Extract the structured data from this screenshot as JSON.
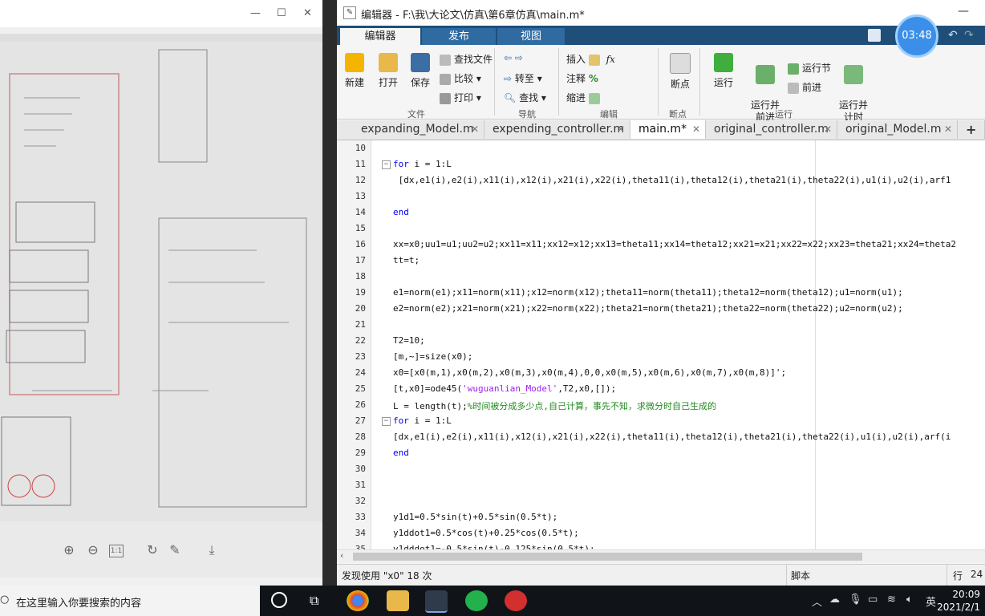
{
  "viewer": {
    "controls": {
      "minimize": "—",
      "maximize": "☐",
      "close": "✕"
    }
  },
  "editor": {
    "title": "编辑器 - F:\\我\\大论文\\仿真\\第6章仿真\\main.m*",
    "ribbon_tabs": [
      "编辑器",
      "发布",
      "视图"
    ],
    "file_group": {
      "new": "新建",
      "open": "打开",
      "save": "保存",
      "find_files": "查找文件",
      "compare": "比较",
      "print": "打印",
      "label": "文件"
    },
    "nav_group": {
      "goto": "转至",
      "find": "查找",
      "label": "导航"
    },
    "edit_group": {
      "insert": "插入",
      "comment": "注释",
      "indent": "缩进",
      "fx": "fx",
      "label": "编辑"
    },
    "breakpoint_group": {
      "breakpoints": "断点",
      "label": "断点"
    },
    "run_group": {
      "run": "运行",
      "run_advance": "运行并\n前进",
      "run_section": "运行节",
      "advance": "前进",
      "run_time": "运行并\n计时",
      "label": "运行"
    },
    "doc_tabs": [
      {
        "name": "expanding_Model.m",
        "active": false
      },
      {
        "name": "expending_controller.m",
        "active": false
      },
      {
        "name": "main.m*",
        "active": true
      },
      {
        "name": "original_controller.m",
        "active": false
      },
      {
        "name": "original_Model.m",
        "active": false
      }
    ],
    "add_tab": "+",
    "code_lines": [
      {
        "n": "10",
        "text": ""
      },
      {
        "n": "11",
        "text": "for i = 1:L"
      },
      {
        "n": "12",
        "text": " [dx,e1(i),e2(i),x11(i),x12(i),x21(i),x22(i),theta11(i),theta12(i),theta21(i),theta22(i),u1(i),u2(i),arf1"
      },
      {
        "n": "13",
        "text": ""
      },
      {
        "n": "14",
        "text": "end"
      },
      {
        "n": "15",
        "text": ""
      },
      {
        "n": "16",
        "text": "xx=x0;uu1=u1;uu2=u2;xx11=x11;xx12=x12;xx13=theta11;xx14=theta12;xx21=x21;xx22=x22;xx23=theta21;xx24=theta2"
      },
      {
        "n": "17",
        "text": "tt=t;"
      },
      {
        "n": "18",
        "text": ""
      },
      {
        "n": "19",
        "text": "e1=norm(e1);x11=norm(x11);x12=norm(x12);theta11=norm(theta11);theta12=norm(theta12);u1=norm(u1);"
      },
      {
        "n": "20",
        "text": "e2=norm(e2);x21=norm(x21);x22=norm(x22);theta21=norm(theta21);theta22=norm(theta22);u2=norm(u2);"
      },
      {
        "n": "21",
        "text": ""
      },
      {
        "n": "22",
        "text": "T2=10;"
      },
      {
        "n": "23",
        "text": "[m,~]=size(x0);"
      },
      {
        "n": "24",
        "text": "x0=[x0(m,1),x0(m,2),x0(m,3),x0(m,4),0,0,x0(m,5),x0(m,6),x0(m,7),x0(m,8)]';"
      },
      {
        "n": "25",
        "text": "[t,x0]=ode45('wuguanlian_Model',T2,x0,[]);"
      },
      {
        "n": "26",
        "text": "L = length(t);%时间被分成多少点,自己计算，事先不知，求微分时自己生成的"
      },
      {
        "n": "27",
        "text": "for i = 1:L"
      },
      {
        "n": "28",
        "text": "[dx,e1(i),e2(i),x11(i),x12(i),x21(i),x22(i),theta11(i),theta12(i),theta21(i),theta22(i),u1(i),u2(i),arf(i"
      },
      {
        "n": "29",
        "text": "end"
      },
      {
        "n": "30",
        "text": ""
      },
      {
        "n": "31",
        "text": ""
      },
      {
        "n": "32",
        "text": ""
      },
      {
        "n": "33",
        "text": "y1d1=0.5*sin(t)+0.5*sin(0.5*t);"
      },
      {
        "n": "34",
        "text": "y1ddot1=0.5*cos(t)+0.25*cos(0.5*t);"
      },
      {
        "n": "35",
        "text": "y1dddot1=-0.5*sin(t)-0.125*sin(0.5*t);"
      }
    ],
    "status": {
      "message": "发现使用 \"x0\" 18 次",
      "type": "脚本",
      "line_label": "行",
      "line_value": "24"
    }
  },
  "timer": "03:48",
  "taskbar": {
    "search_placeholder": "在这里输入你要搜索的内容",
    "ime": "英",
    "time": "20:09",
    "date": "2021/2/1"
  },
  "colors": {
    "ribbon_blue": "#1f4e79",
    "keyword": "#0000ff",
    "string": "#a020f0",
    "comment": "#228b22"
  }
}
